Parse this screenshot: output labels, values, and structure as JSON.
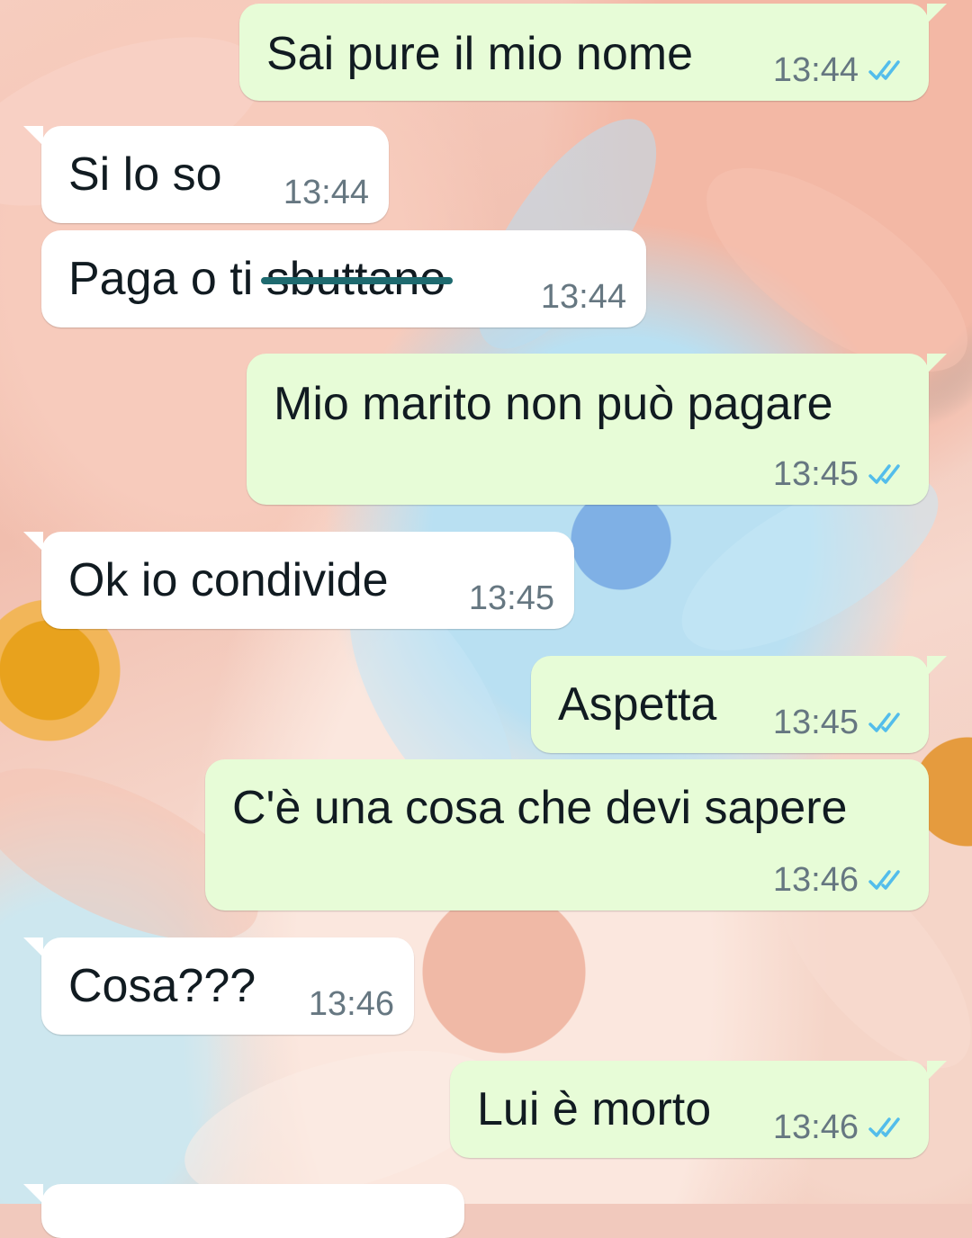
{
  "colors": {
    "outgoing_bubble": "#e7fcd7",
    "incoming_bubble": "#ffffff",
    "read_ticks": "#53bdeb",
    "timestamp": "#667781",
    "strike_line": "#1e6a6f"
  },
  "icons": {
    "read_receipt": "double-check-icon"
  },
  "messages": [
    {
      "direction": "outgoing",
      "text": "Sai pure il mio nome",
      "time": "13:44",
      "status": "read"
    },
    {
      "direction": "incoming",
      "text": "Si lo so",
      "time": "13:44"
    },
    {
      "direction": "incoming",
      "text_plain": "Paga o ti ",
      "text_struck": "sbuttano",
      "time": "13:44"
    },
    {
      "direction": "outgoing",
      "text": "Mio marito non può pagare",
      "time": "13:45",
      "status": "read"
    },
    {
      "direction": "incoming",
      "text": "Ok io condivide",
      "time": "13:45"
    },
    {
      "direction": "outgoing",
      "text": "Aspetta",
      "time": "13:45",
      "status": "read"
    },
    {
      "direction": "outgoing",
      "text": "C'è una cosa che devi sapere",
      "time": "13:46",
      "status": "read"
    },
    {
      "direction": "incoming",
      "text": "Cosa???",
      "time": "13:46"
    },
    {
      "direction": "outgoing",
      "text": "Lui è morto",
      "time": "13:46",
      "status": "read"
    }
  ]
}
